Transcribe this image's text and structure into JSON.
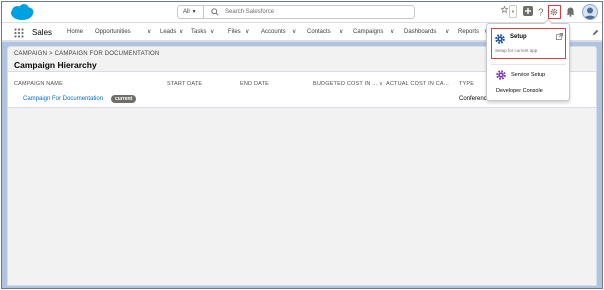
{
  "header": {
    "search_scope": "All",
    "search_placeholder": "Search Salesforce"
  },
  "nav": {
    "app_name": "Sales",
    "items": [
      "Home",
      "Opportunities",
      "Leads",
      "Tasks",
      "Files",
      "Accounts",
      "Contacts",
      "Campaigns",
      "Dashboards",
      "Reports"
    ]
  },
  "page": {
    "breadcrumb": "CAMPAIGN > CAMPAIGN FOR DOCUMENTATION",
    "title": "Campaign Hierarchy"
  },
  "table": {
    "columns": [
      "CAMPAIGN NAME",
      "START DATE",
      "END DATE",
      "BUDGETED COST IN ...",
      "ACTUAL COST IN CA...",
      "TYPE"
    ],
    "rows": [
      {
        "name": "Campaign For Documentation",
        "badge": "current",
        "type": "Conference"
      }
    ]
  },
  "setup_menu": {
    "setup_title": "Setup",
    "setup_subtitle": "Setup for current app",
    "service_setup": "Service Setup",
    "developer_console": "Developer Console"
  },
  "colors": {
    "brand_blue": "#00a1e0",
    "link": "#006dcc",
    "highlight_red": "#e03a3e",
    "background": "#b0c4df"
  }
}
